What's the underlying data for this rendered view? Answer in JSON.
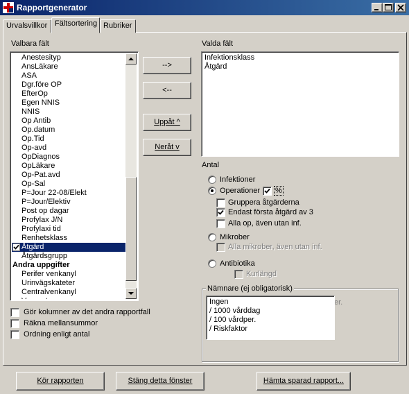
{
  "window": {
    "title": "Rapportgenerator",
    "minimize_label": "minimize",
    "maximize_label": "maximize",
    "close_label": "close"
  },
  "tabs": [
    {
      "label": "Urvalsvillkor",
      "active": false
    },
    {
      "label": "Fältsortering",
      "active": true
    },
    {
      "label": "Rubriker",
      "active": false
    }
  ],
  "available_fields": {
    "label": "Valbara fält",
    "items": [
      "Anestesityp",
      "AnsLäkare",
      "ASA",
      "Dgr.före OP",
      "EfterOp",
      "Egen NNIS",
      "NNIS",
      "Op Antib",
      "Op.datum",
      "Op.Tid",
      "Op-avd",
      "OpDiagnos",
      "OpLäkare",
      "Op-Pat.avd",
      "Op-Sal",
      "P=Jour 22-08/Elekt",
      "P=Jour/Elektiv",
      "Post op dagar",
      "Profylax J/N",
      "Profylaxi tid",
      "Renhetsklass",
      "Åtgärd",
      "Åtgärdsgrupp",
      "Andra uppgifter",
      "Perifer venkanyl",
      "Urinvägskateter",
      "Centralvenkanyl",
      "Venport"
    ],
    "selected_item": "Åtgärd",
    "checked_item": "Åtgärd",
    "group_header_item": "Andra uppgifter"
  },
  "move_buttons": {
    "add": "-->",
    "remove": "<--",
    "up": "Uppåt  ^",
    "down": "Neråt  v"
  },
  "chosen_fields": {
    "label": "Valda fält",
    "items": [
      "Infektionsklass",
      "Åtgärd"
    ]
  },
  "antal": {
    "label": "Antal",
    "infektioner": "Infektioner",
    "operationer": "Operationer",
    "percent": "%",
    "gruppera": "Gruppera åtgärderna",
    "endast_forsta": "Endast första åtgärd av 3",
    "alla_op": "Alla op, även utan inf.",
    "mikrober": "Mikrober",
    "alla_mikrober": "Alla mikrober, även utan inf.",
    "antibiotika": "Antibiotika",
    "kurlangd": "Kurlängd",
    "selected_radio": "Operationer"
  },
  "namnare": {
    "label": "Nämnare (ej obligatorisk)",
    "options": [
      "Ingen",
      "/ 1000 vårddag",
      "/ 100 vårdper.",
      "/ Riskfaktor"
    ],
    "behind_text": "er."
  },
  "options": {
    "gor_kolumner": "Gör kolumner av det andra rapportfall",
    "rakna_mellansummor": "Räkna mellansummor",
    "ordning": "Ordning enligt antal"
  },
  "footer": {
    "run": "Kör rapporten",
    "close": "Stäng detta fönster",
    "load": "Hämta sparad rapport..."
  },
  "colors": {
    "face": "#d4d0c8",
    "selection": "#0a246a",
    "title_start": "#0a246a",
    "title_end": "#3a6ea5"
  }
}
